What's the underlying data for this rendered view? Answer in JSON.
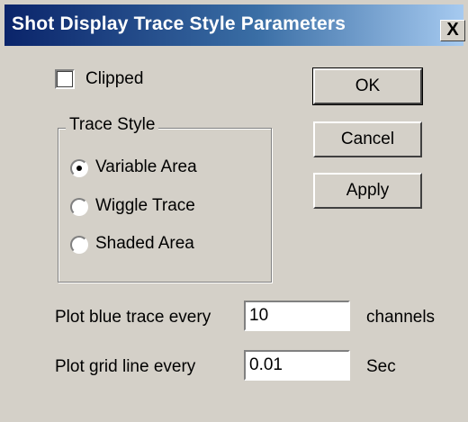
{
  "window": {
    "title": "Shot Display Trace Style Parameters",
    "close_label": "X"
  },
  "clipped": {
    "label": "Clipped",
    "checked": false
  },
  "trace_style": {
    "group_label": "Trace Style",
    "options": [
      {
        "label": "Variable Area",
        "selected": true
      },
      {
        "label": "Wiggle Trace",
        "selected": false
      },
      {
        "label": "Shaded Area",
        "selected": false
      }
    ]
  },
  "buttons": {
    "ok": "OK",
    "cancel": "Cancel",
    "apply": "Apply"
  },
  "fields": {
    "blue_trace": {
      "label": "Plot blue trace every",
      "value": "10",
      "unit": "channels"
    },
    "grid_line": {
      "label": "Plot grid  line every",
      "value": "0.01",
      "unit": "Sec"
    }
  },
  "colors": {
    "dialog_bg": "#d4d0c8",
    "titlebar_start": "#0a246a",
    "titlebar_end": "#a6caf0"
  }
}
